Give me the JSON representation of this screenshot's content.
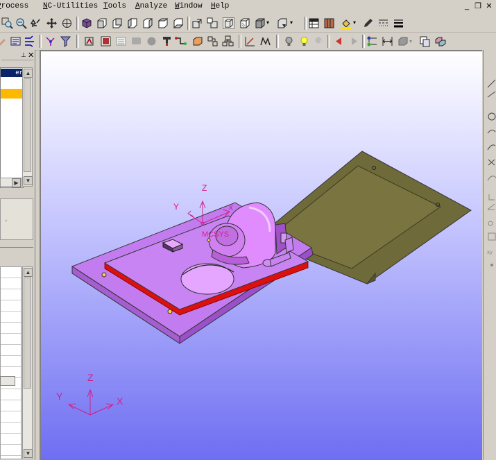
{
  "menubar": {
    "items": [
      {
        "pre": "",
        "u": "P",
        "post": "rocess",
        "full": "Process"
      },
      {
        "pre": "",
        "u": "N",
        "post": "C-Utilities",
        "full": "NC-Utilities"
      },
      {
        "pre": "",
        "u": "T",
        "post": "ools",
        "full": "Tools"
      },
      {
        "pre": "",
        "u": "A",
        "post": "nalyze",
        "full": "Analyze"
      },
      {
        "pre": "",
        "u": "W",
        "post": "indow",
        "full": "Window"
      },
      {
        "pre": "",
        "u": "H",
        "post": "elp",
        "full": "Help"
      }
    ]
  },
  "window_controls": {
    "minimize": "_",
    "restore": "❐",
    "close": "✕"
  },
  "left_panel": {
    "header_text": "er",
    "arrow_up": "▲",
    "arrow_down": "▼",
    "arrow_right": "▶",
    "dropdown_arrow": "-"
  },
  "viewport": {
    "part_triad": {
      "x": "X",
      "y": "Y",
      "z": "Z",
      "label": "MCSYS"
    },
    "view_triad": {
      "x": "X",
      "y": "Y",
      "z": "Z"
    }
  },
  "colors": {
    "viewport_top": "#ffffff",
    "viewport_bottom": "#6e6ef2",
    "part_body": "#c37cf0",
    "part_edge": "#7a2a9a",
    "fixture_plate": "#6f6a3a",
    "red_band": "#dd1010",
    "triad": "#d0208a"
  }
}
